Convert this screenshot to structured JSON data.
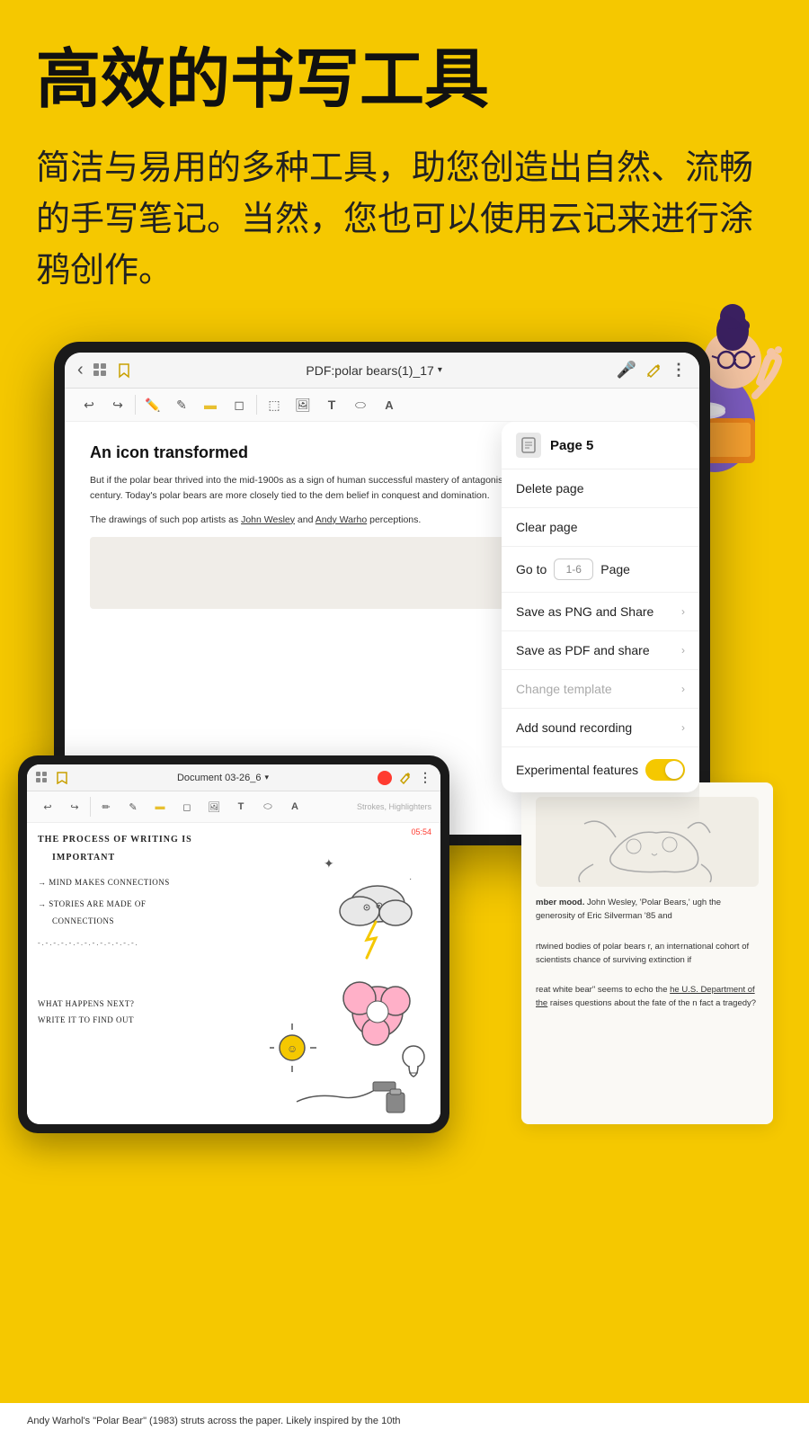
{
  "hero": {
    "title": "高效的书写工具",
    "subtitle": "简洁与易用的多种工具，助您创造出自然、流畅的手写笔记。当然，您也可以使用云记来进行涂鸦创作。"
  },
  "topbar": {
    "title": "PDF:polar bears(1)_17",
    "dropdown_arrow": "∨",
    "back_label": "‹"
  },
  "toolbar": {
    "undo": "↩",
    "redo": "↪",
    "divider": "|",
    "pen": "✏",
    "pencil": "✎",
    "highlighter": "▬",
    "eraser": "◻",
    "lasso": "⬚",
    "image": "⊞",
    "text": "T",
    "shape": "⬭",
    "keyboard": "A"
  },
  "dropdown": {
    "page_title": "Page 5",
    "items": [
      {
        "label": "Delete page",
        "has_chevron": false,
        "disabled": false
      },
      {
        "label": "Clear page",
        "has_chevron": false,
        "disabled": false
      },
      {
        "label": "Go to",
        "goto": true,
        "placeholder": "1-6",
        "page_label": "Page",
        "disabled": false
      },
      {
        "label": "Save as PNG and Share",
        "has_chevron": true,
        "disabled": false
      },
      {
        "label": "Save as PDF and share",
        "has_chevron": true,
        "disabled": false
      },
      {
        "label": "Change template",
        "has_chevron": true,
        "disabled": true
      },
      {
        "label": "Add sound recording",
        "has_chevron": true,
        "disabled": false
      },
      {
        "label": "Experimental features",
        "has_toggle": true,
        "disabled": false
      }
    ]
  },
  "doc": {
    "title": "An icon transformed",
    "paragraph1": "But if the polar bear thrived into the mid-1900s as a sign of human successful mastery of antagonistic forces, this symbolic associatio 20th century. Today's polar bears are more closely tied to the dem belief in conquest and domination.",
    "paragraph2": "The drawings of such pop artists as John Wesley and Andy Warho perceptions."
  },
  "small_device": {
    "title": "Document 03-26_6",
    "timer": "05:54",
    "strokes_label": "Strokes, Highlighters",
    "handwriting_lines": [
      "The process of writing is",
      "  important",
      "",
      "  → mind makes connections",
      "",
      "  → stories are made of",
      "      connections",
      "",
      "  -.-.-.-.-.-.-.-.-.-.-.-.-.-.-.-.-.-.-.-.-.-..",
      "",
      "what happens next?",
      "write it to find out"
    ]
  },
  "bottom_strip": {
    "text": "Andy Warhol's \"Polar Bear\" (1983) struts across the paper. Likely inspired by the 10th"
  },
  "doc_partial": {
    "text1": "mber mood. John Wesley, 'Polar Bears,' ugh the generosity of Eric Silverman '85 and",
    "text2": "rtwined bodies of polar bears r, an international cohort of scientists chance of surviving extinction if",
    "text3": "reat white bear\" seems to echo the he U.S. Department of the raises questions about the fate of the n fact a tragedy?",
    "text4": "Department of the"
  },
  "icons": {
    "mic": "🎤",
    "pencil_gold": "✏",
    "more": "⋮",
    "chevron": "›",
    "grid": "⊞",
    "bookmark": "🔖",
    "back": "‹"
  }
}
